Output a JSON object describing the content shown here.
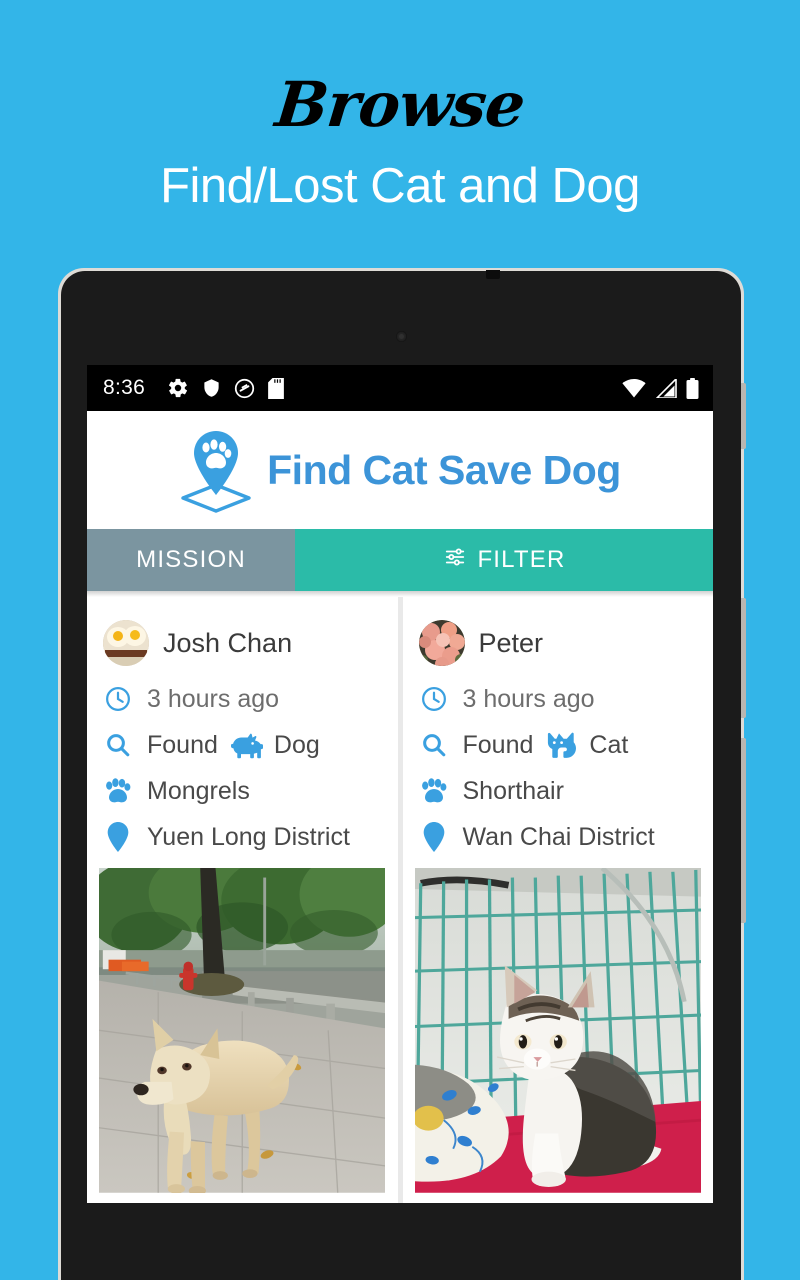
{
  "promo": {
    "title": "Browse",
    "subtitle": "Find/Lost Cat and Dog",
    "background_color": "#33b5e8"
  },
  "device": {
    "type": "android-tablet",
    "frame_color": "#dedbd6",
    "bezel_color": "#1b1b1b"
  },
  "status_bar": {
    "time": "8:36",
    "left_icons": [
      "gear-icon",
      "shield-icon",
      "do-not-disturb-icon",
      "sd-card-icon"
    ],
    "right_icons": [
      "wifi-icon",
      "cell-signal-icon",
      "battery-icon"
    ],
    "background_color": "#000000"
  },
  "app_bar": {
    "title": "Find Cat Save Dog",
    "logo": "map-pin-paw-icon",
    "title_color": "#3c94d8"
  },
  "tabs": [
    {
      "label": "MISSION",
      "icon": null,
      "active": false,
      "color": "#7b95a0"
    },
    {
      "label": "FILTER",
      "icon": "tune-icon",
      "active": true,
      "color": "#2bbba8"
    }
  ],
  "cards": [
    {
      "author": "Josh Chan",
      "avatar": "fried-eggs-photo",
      "time": "3 hours ago",
      "status": "Found",
      "species": "Dog",
      "species_icon": "dog-icon",
      "breed": "Mongrels",
      "district": "Yuen Long District",
      "photo": "tan-street-dog-on-sidewalk"
    },
    {
      "author": "Peter",
      "avatar": "pink-flowers-photo",
      "time": "3 hours ago",
      "status": "Found",
      "species": "Cat",
      "species_icon": "cat-icon",
      "breed": "Shorthair",
      "district": "Wan Chai District",
      "photo": "tabby-white-kitten-in-cage"
    }
  ],
  "icons": {
    "clock": "clock-icon",
    "search": "magnifier-icon",
    "paw": "paw-icon",
    "pin": "location-pin-icon"
  },
  "colors": {
    "accent_blue": "#3aa0e0",
    "teal": "#2bbba8",
    "gray_tab": "#7b95a0",
    "text": "#494949"
  }
}
